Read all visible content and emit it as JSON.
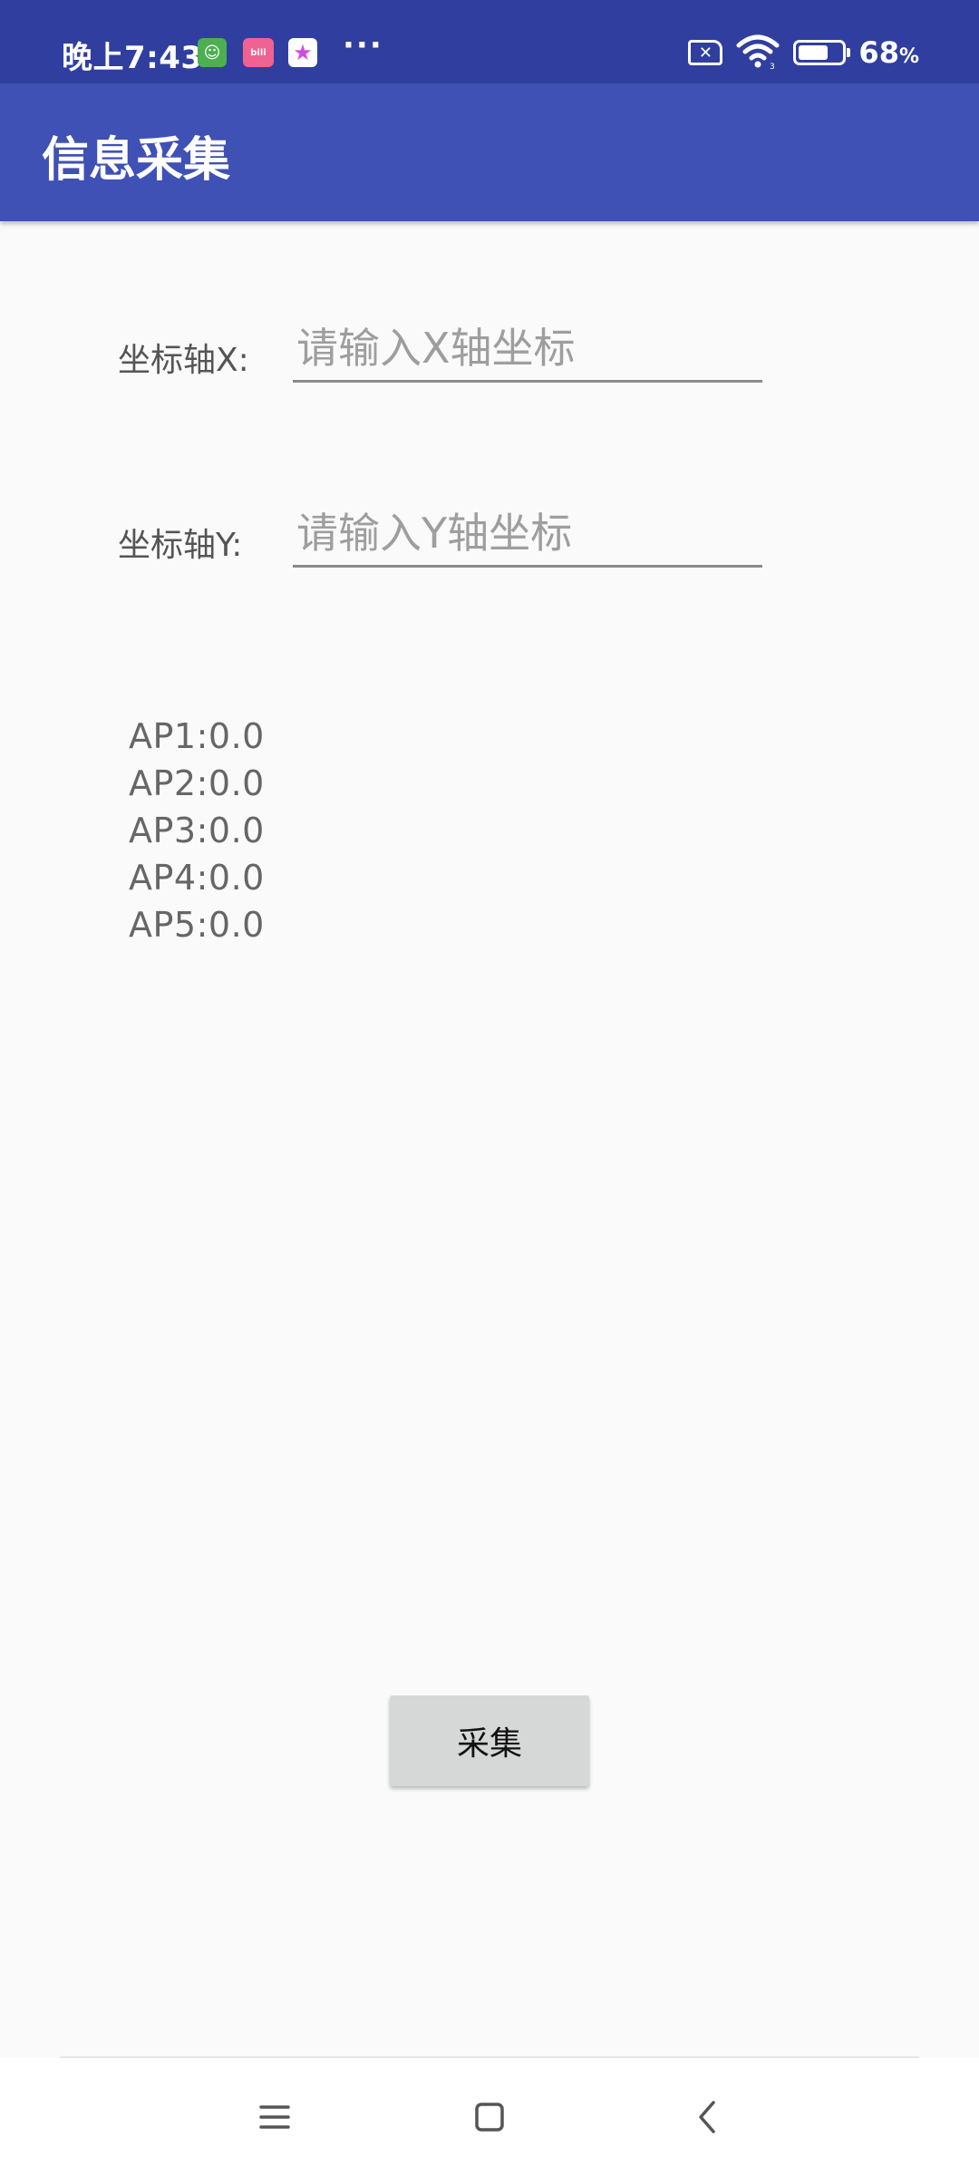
{
  "status_bar": {
    "time": "晚上7:43",
    "dots": "···",
    "battery_level": "68",
    "battery_unit": "%",
    "battery_fraction": 0.68,
    "icons": [
      "wechat-like-icon",
      "bilibili-icon",
      "star-app-icon",
      "sim-off-icon",
      "wifi-icon",
      "battery-icon"
    ]
  },
  "toolbar": {
    "title": "信息采集",
    "color": "#3f51b5"
  },
  "form": {
    "x_label": "坐标轴X:",
    "x_placeholder": "请输入X轴坐标",
    "y_label": "坐标轴Y:",
    "y_placeholder": "请输入Y轴坐标"
  },
  "ap_readings": [
    "AP1:0.0",
    "AP2:0.0",
    "AP3:0.0",
    "AP4:0.0",
    "AP5:0.0"
  ],
  "actions": {
    "collect_label": "采集"
  },
  "nav": {
    "icons": [
      "menu-icon",
      "home-icon",
      "back-icon"
    ]
  }
}
